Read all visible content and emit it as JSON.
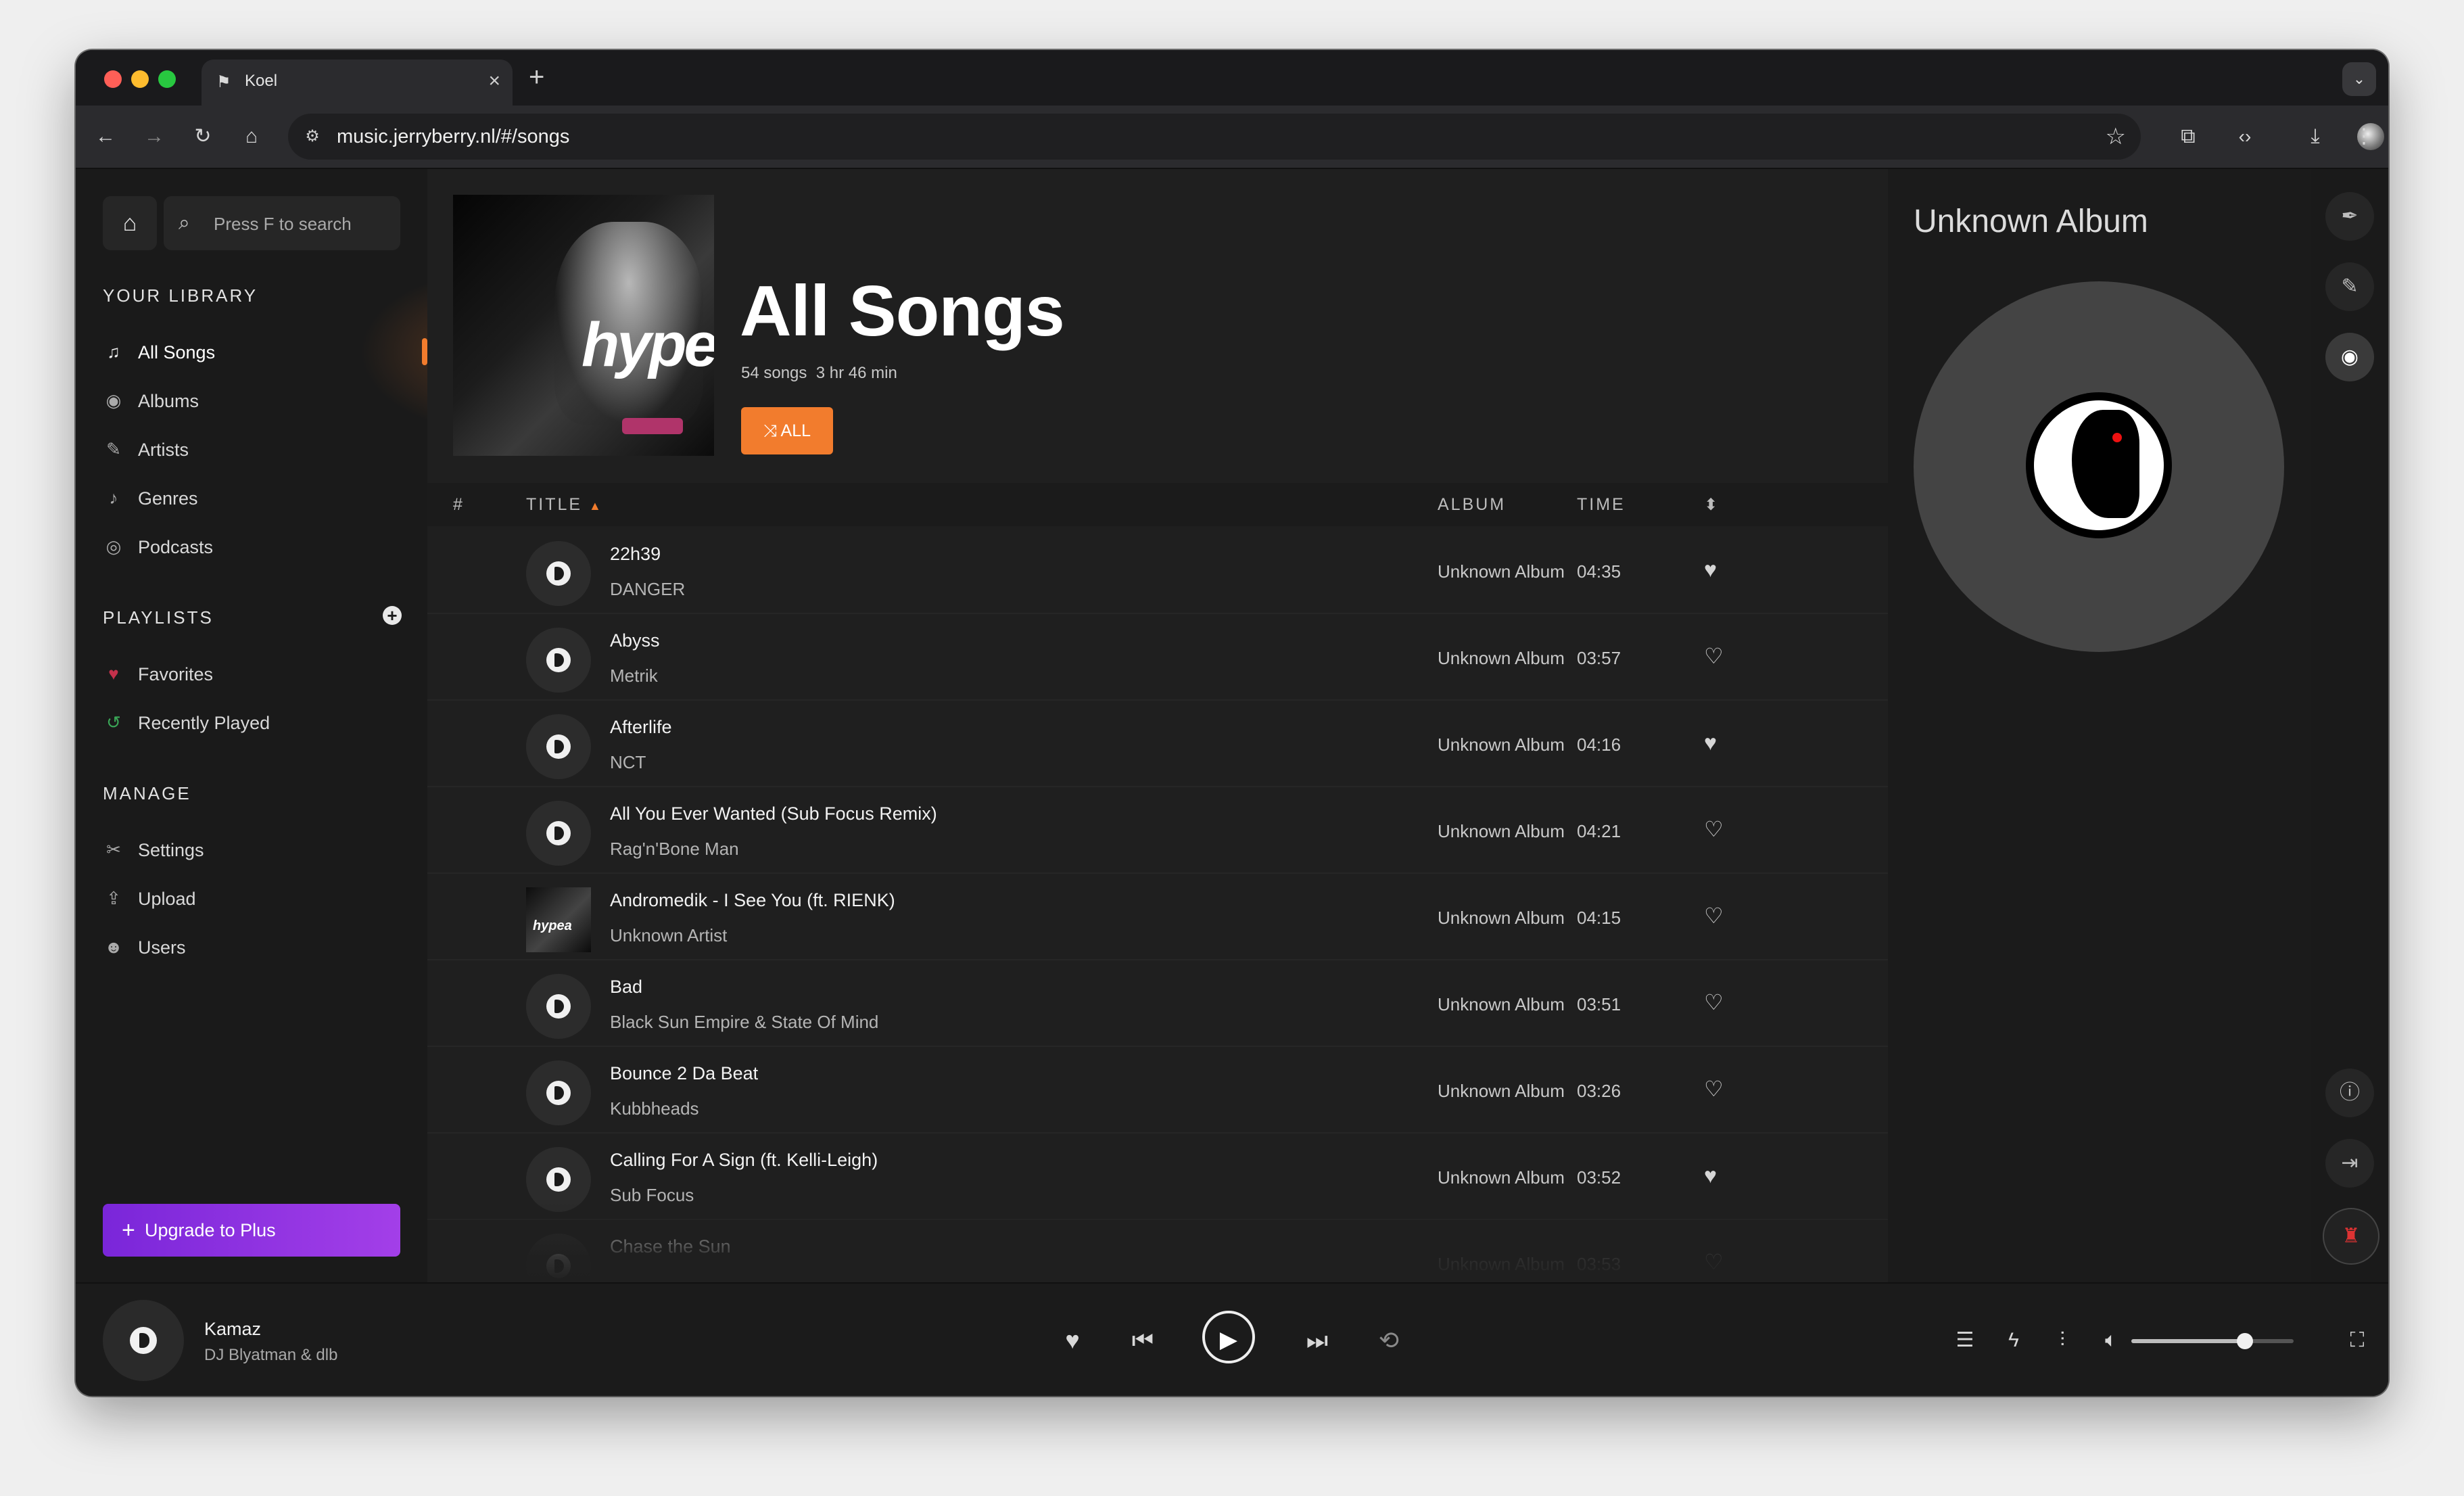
{
  "browser": {
    "tab_title": "Koel",
    "url": "music.jerryberry.nl/#/songs"
  },
  "search": {
    "placeholder": "Press F to search"
  },
  "sidebar": {
    "library_heading": "YOUR LIBRARY",
    "library_items": [
      {
        "label": "All Songs",
        "icon": "music-note-icon"
      },
      {
        "label": "Albums",
        "icon": "disc-icon"
      },
      {
        "label": "Artists",
        "icon": "microphone-icon"
      },
      {
        "label": "Genres",
        "icon": "guitar-icon"
      },
      {
        "label": "Podcasts",
        "icon": "podcast-icon"
      }
    ],
    "playlists_heading": "PLAYLISTS",
    "playlist_items": [
      {
        "label": "Favorites",
        "icon": "heart-icon"
      },
      {
        "label": "Recently Played",
        "icon": "history-icon"
      }
    ],
    "manage_heading": "MANAGE",
    "manage_items": [
      {
        "label": "Settings",
        "icon": "tools-icon"
      },
      {
        "label": "Upload",
        "icon": "upload-icon"
      },
      {
        "label": "Users",
        "icon": "users-icon"
      }
    ],
    "upgrade_label": "Upgrade to Plus"
  },
  "header": {
    "title": "All Songs",
    "song_count": "54 songs",
    "duration": "3 hr 46 min",
    "shuffle_label": "ALL",
    "cover_text": "hype"
  },
  "table": {
    "col_number": "#",
    "col_title": "TITLE",
    "col_album": "ALBUM",
    "col_time": "TIME",
    "rows": [
      {
        "title": "22h39",
        "artist": "DANGER",
        "album": "Unknown Album",
        "time": "04:35",
        "liked": true,
        "thumb": "disc"
      },
      {
        "title": "Abyss",
        "artist": "Metrik",
        "album": "Unknown Album",
        "time": "03:57",
        "liked": false,
        "thumb": "disc"
      },
      {
        "title": "Afterlife",
        "artist": "NCT",
        "album": "Unknown Album",
        "time": "04:16",
        "liked": true,
        "thumb": "disc"
      },
      {
        "title": "All You Ever Wanted (Sub Focus Remix)",
        "artist": "Rag'n'Bone Man",
        "album": "Unknown Album",
        "time": "04:21",
        "liked": false,
        "thumb": "disc"
      },
      {
        "title": "Andromedik - I See You (ft. RIENK)",
        "artist": "Unknown Artist",
        "album": "Unknown Album",
        "time": "04:15",
        "liked": false,
        "thumb": "cover",
        "thumb_text": "hypea"
      },
      {
        "title": "Bad",
        "artist": "Black Sun Empire & State Of Mind",
        "album": "Unknown Album",
        "time": "03:51",
        "liked": false,
        "thumb": "disc"
      },
      {
        "title": "Bounce 2 Da Beat",
        "artist": "Kubbheads",
        "album": "Unknown Album",
        "time": "03:26",
        "liked": false,
        "thumb": "disc"
      },
      {
        "title": "Calling For A Sign (ft. Kelli-Leigh)",
        "artist": "Sub Focus",
        "album": "Unknown Album",
        "time": "03:52",
        "liked": true,
        "thumb": "disc"
      },
      {
        "title": "Chase the Sun",
        "artist": "",
        "album": "Unknown Album",
        "time": "03:53",
        "liked": false,
        "thumb": "disc"
      }
    ]
  },
  "extra_panel": {
    "title": "Unknown Album"
  },
  "player": {
    "title": "Kamaz",
    "artist": "DJ Blyatman & dlb",
    "volume": 0.7
  },
  "colors": {
    "accent": "#f27c2d",
    "upgrade": "#8a2be2",
    "background": "#1f1f1f"
  }
}
